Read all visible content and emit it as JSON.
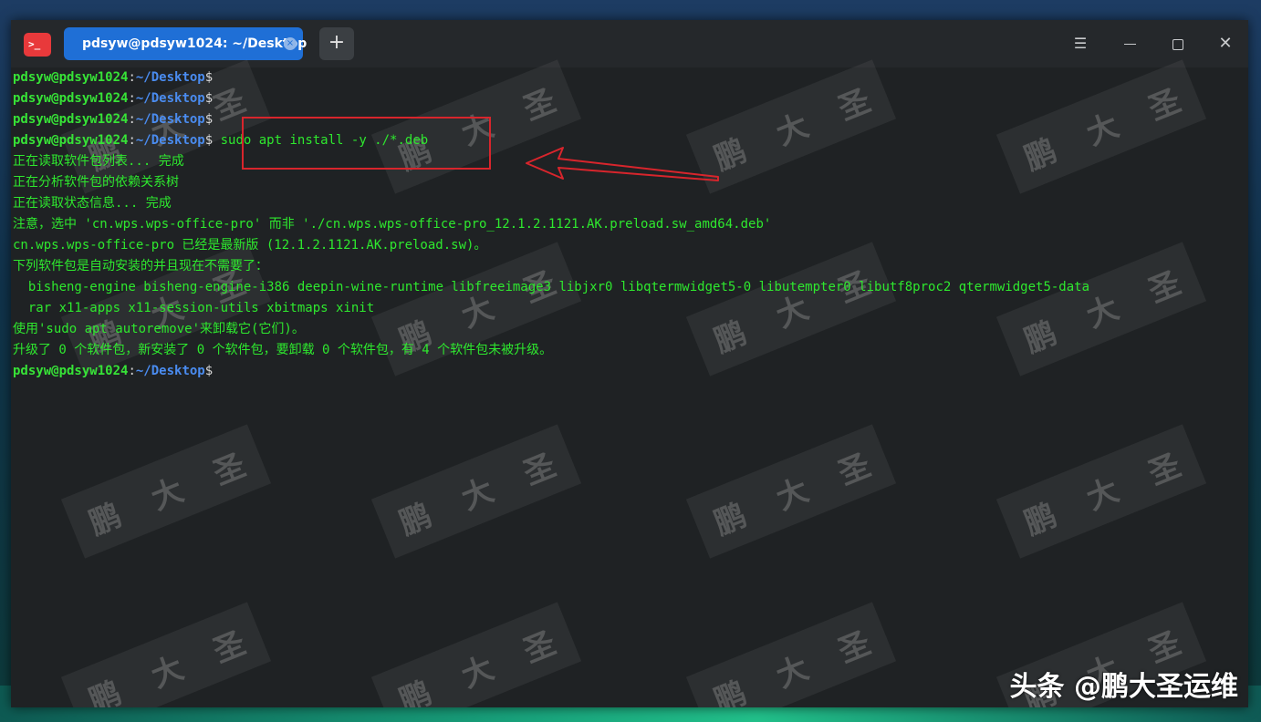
{
  "window": {
    "tab_title": "pdsyw@pdsyw1024: ~/Desktop",
    "tab_close": "×",
    "new_tab": "+",
    "app_icon_glyph": ">_"
  },
  "terminal": {
    "prompt_user": "pdsyw@pdsyw1024",
    "prompt_colon": ":",
    "prompt_path": "~/Desktop",
    "prompt_dollar": "$",
    "command": "sudo apt install -y ./*.deb",
    "output": [
      "正在读取软件包列表... 完成",
      "正在分析软件包的依赖关系树",
      "正在读取状态信息... 完成",
      "注意，选中 'cn.wps.wps-office-pro' 而非 './cn.wps.wps-office-pro_12.1.2.1121.AK.preload.sw_amd64.deb'",
      "cn.wps.wps-office-pro 已经是最新版 (12.1.2.1121.AK.preload.sw)。",
      "下列软件包是自动安装的并且现在不需要了：",
      "  bisheng-engine bisheng-engine-i386 deepin-wine-runtime libfreeimage3 libjxr0 libqtermwidget5-0 libutempter0 libutf8proc2 qtermwidget5-data",
      "  rar x11-apps x11-session-utils xbitmaps xinit",
      "使用'sudo apt autoremove'来卸载它(它们)。",
      "升级了 0 个软件包，新安装了 0 个软件包，要卸载 0 个软件包，有 4 个软件包未被升级。"
    ]
  },
  "watermark": {
    "c1": "鹏",
    "c2": "大",
    "c3": "圣"
  },
  "brand": "头条 @鹏大圣运维",
  "colors": {
    "prompt_user": "#37e337",
    "prompt_path": "#4a8cf0",
    "output_text": "#2ee82e",
    "tab_active": "#1f6fd6",
    "annotation_red": "#d8252c",
    "terminal_bg": "#1f2224"
  },
  "icons": [
    "terminal-app-icon",
    "tab-close-icon",
    "plus-icon",
    "menu-icon",
    "minimize-icon",
    "maximize-icon",
    "close-icon",
    "arrow-annotation"
  ]
}
